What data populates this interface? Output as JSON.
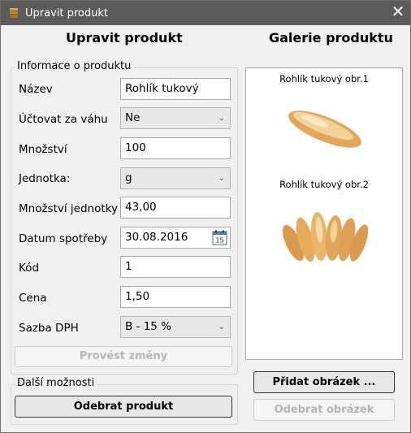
{
  "window": {
    "title": "Upravit produkt",
    "close_symbol": "✕"
  },
  "left": {
    "heading": "Upravit produkt",
    "group_title": "Informace o produktu",
    "fields": [
      {
        "label": "Název",
        "value": "Rohlík tukový",
        "type": "text"
      },
      {
        "label": "Účtovat za váhu",
        "value": "Ne",
        "type": "combo"
      },
      {
        "label": "Množství",
        "value": "100",
        "type": "text"
      },
      {
        "label": "Jednotka:",
        "value": "g",
        "type": "combo"
      },
      {
        "label": "Množství jednotky",
        "value": "43,00",
        "type": "text"
      },
      {
        "label": "Datum spotřeby",
        "value": "30.08.2016",
        "type": "date",
        "calendar_day": "15"
      },
      {
        "label": "Kód",
        "value": "1",
        "type": "text"
      },
      {
        "label": "Cena",
        "value": "1,50",
        "type": "text"
      },
      {
        "label": "Sazba DPH",
        "value": "B - 15 %",
        "type": "combo"
      }
    ],
    "apply_button": "Provést změny",
    "more_title": "Další možnosti",
    "remove_product_button": "Odebrat produkt"
  },
  "right": {
    "heading": "Galerie produktu",
    "images": [
      {
        "caption": "Rohlík tukový obr.1"
      },
      {
        "caption": "Rohlík tukový obr.2"
      }
    ],
    "add_image_button": "Přidat obrázek ...",
    "remove_image_button": "Odebrat obrázek"
  },
  "colors": {
    "titlebar": "#5b5b5b",
    "window_bg": "#f0f0f0",
    "disabled_text": "#b5b5b5",
    "bread": "#e2a65a"
  },
  "icons": {
    "app": "product-app-icon",
    "close": "close-icon",
    "dropdown": "chevron-down-icon",
    "calendar": "calendar-icon"
  }
}
